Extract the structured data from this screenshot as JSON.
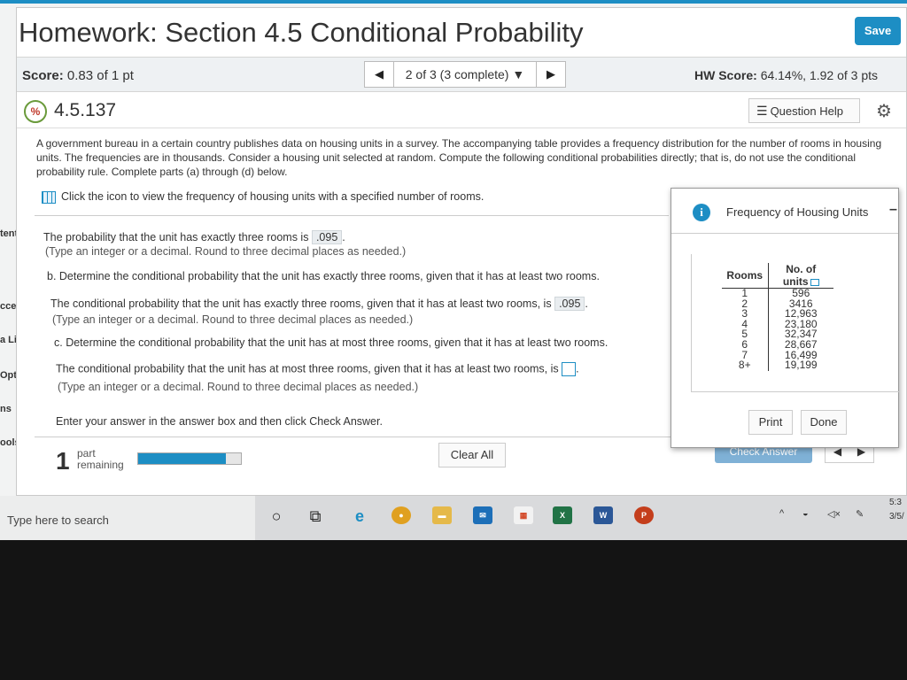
{
  "sidebar_partial": [
    "tents",
    "ccess",
    "a Librai",
    "Options",
    "ns",
    "ools"
  ],
  "header": {
    "title": "Homework: Section 4.5 Conditional Probability",
    "save_label": "Save"
  },
  "scorebar": {
    "score_label": "Score:",
    "score_value": "0.83 of 1 pt",
    "prev_icon": "left-triangle",
    "question_select": "2 of 3 (3 complete) ▼",
    "next_icon": "right-triangle",
    "hw_score_label": "HW Score:",
    "hw_score_value": "64.14%, 1.92 of 3 pts"
  },
  "question": {
    "number": "4.5.137",
    "help_label": "Question Help",
    "status_icon": "partial-credit-icon",
    "problem_text": "A government bureau in a certain country publishes data on housing units in a survey. The accompanying table provides a frequency distribution for the number of rooms in housing units. The frequencies are in thousands. Consider a housing unit selected at random. Compute the following conditional probabilities directly; that is, do not use the conditional probability rule. Complete parts (a) through (d) below.",
    "icon_link_text": "Click the icon to view the frequency of housing units with a specified number of rooms.",
    "a_text": "The probability that the unit has exactly three rooms is",
    "a_answer": ".095",
    "a_hint": "(Type an integer or a decimal. Round to three decimal places as needed.)",
    "b_prompt": "b. Determine the conditional probability that the unit has exactly three rooms, given that it has at least two rooms.",
    "b_text": "The conditional probability that the unit has exactly three rooms, given that it has at least two rooms, is",
    "b_answer": ".095",
    "b_hint": "(Type an integer or a decimal. Round to three decimal places as needed.)",
    "c_prompt": "c. Determine the conditional probability that the unit has at most three rooms, given that it has at least two rooms.",
    "c_text": "The conditional probability that the unit has at most three rooms, given that it has at least two rooms, is",
    "c_hint": "(Type an integer or a decimal. Round to three decimal places as needed.)",
    "enter_text": "Enter your answer in the answer box and then click Check Answer."
  },
  "footer": {
    "parts_remaining": "1",
    "parts_word": "part",
    "remaining_word": "remaining",
    "progress_fraction": 0.85,
    "clear_all": "Clear All",
    "check_answer": "Check Answer"
  },
  "popup": {
    "title": "Frequency of Housing Units",
    "minimize": "–",
    "columns": [
      "Rooms",
      "No. of units"
    ],
    "rows": [
      [
        "1",
        "596"
      ],
      [
        "2",
        "3416"
      ],
      [
        "3",
        "12,963"
      ],
      [
        "4",
        "23,180"
      ],
      [
        "5",
        "32,347"
      ],
      [
        "6",
        "28,667"
      ],
      [
        "7",
        "16,499"
      ],
      [
        "8+",
        "19,199"
      ]
    ],
    "print_label": "Print",
    "done_label": "Done"
  },
  "taskbar": {
    "search_placeholder": "Type here to search",
    "clock_time": "5:3",
    "clock_date": "3/5/"
  },
  "colors": {
    "accent": "#1d8ec4",
    "check_answer": "#7fb1d6",
    "taskbar": "#d9dadc"
  }
}
